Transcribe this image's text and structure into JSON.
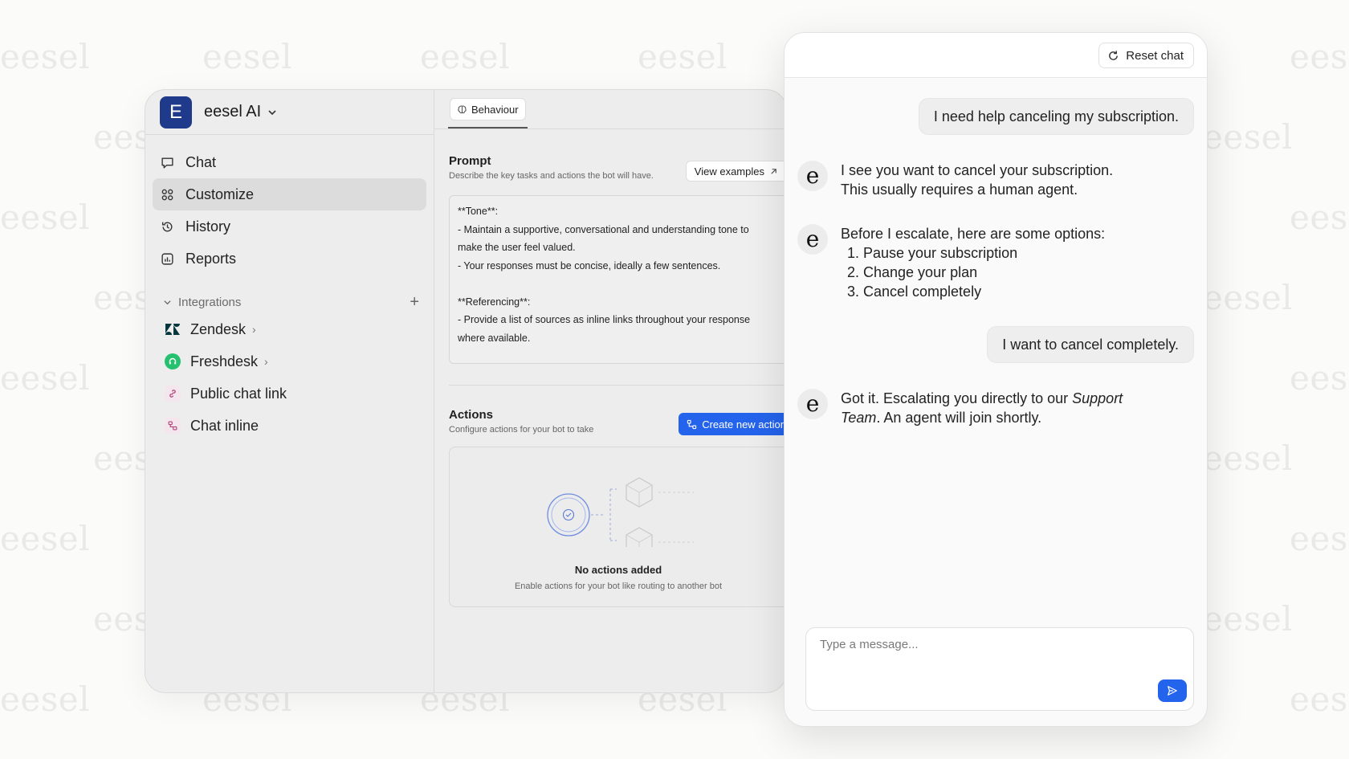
{
  "watermark": "eesel",
  "workspace": {
    "logo_letter": "E",
    "name": "eesel AI"
  },
  "nav": [
    {
      "label": "Chat",
      "icon": "chat-bubble-icon",
      "active": false
    },
    {
      "label": "Customize",
      "icon": "grid-icon",
      "active": true
    },
    {
      "label": "History",
      "icon": "history-icon",
      "active": false
    },
    {
      "label": "Reports",
      "icon": "reports-icon",
      "active": false
    }
  ],
  "integrations": {
    "heading": "Integrations",
    "add_label": "+",
    "items": [
      {
        "label": "Zendesk",
        "icon": "zendesk-icon",
        "has_chevron": true
      },
      {
        "label": "Freshdesk",
        "icon": "freshdesk-icon",
        "has_chevron": true
      },
      {
        "label": "Public chat link",
        "icon": "link-icon",
        "has_chevron": false
      },
      {
        "label": "Chat inline",
        "icon": "chat-inline-icon",
        "has_chevron": false
      }
    ]
  },
  "tabs": [
    {
      "label": "Behaviour",
      "icon": "brain-icon"
    }
  ],
  "prompt": {
    "title": "Prompt",
    "subtitle": "Describe the key tasks and actions the bot will have.",
    "view_examples": "View examples",
    "text": "**Tone**:\n- Maintain a supportive, conversational and understanding tone to\nmake the user feel valued.\n- Your responses must be concise, ideally a few sentences.\n\n**Referencing**:\n- Provide a list of sources as inline links throughout your response\nwhere available."
  },
  "actions": {
    "title": "Actions",
    "subtitle": "Configure actions for your bot to take",
    "create_label": "Create new action",
    "empty_title": "No actions added",
    "empty_subtitle": "Enable actions for your bot like routing to another bot"
  },
  "chat": {
    "reset_label": "Reset chat",
    "bot_avatar_letter": "e",
    "messages": [
      {
        "role": "user",
        "text": "I need help canceling my subscription."
      },
      {
        "role": "bot",
        "text_line1": "I see you want to cancel your subscription.",
        "text_line2": "This usually requires a human agent."
      },
      {
        "role": "bot",
        "intro": "Before I escalate, here are some options:",
        "options": [
          "Pause your subscription",
          "Change your plan",
          "Cancel completely"
        ]
      },
      {
        "role": "user",
        "text": "I want to cancel completely."
      },
      {
        "role": "bot",
        "text_before": "Got it. Escalating you directly to our ",
        "emphasis": "Support Team",
        "text_after": ". An agent will join shortly."
      }
    ],
    "composer_placeholder": "Type a message...",
    "send_icon": "send-icon"
  },
  "colors": {
    "accent": "#2463eb",
    "workspace_logo": "#1f3a8a",
    "freshdesk": "#25c16f",
    "zendesk": "#03363d"
  }
}
